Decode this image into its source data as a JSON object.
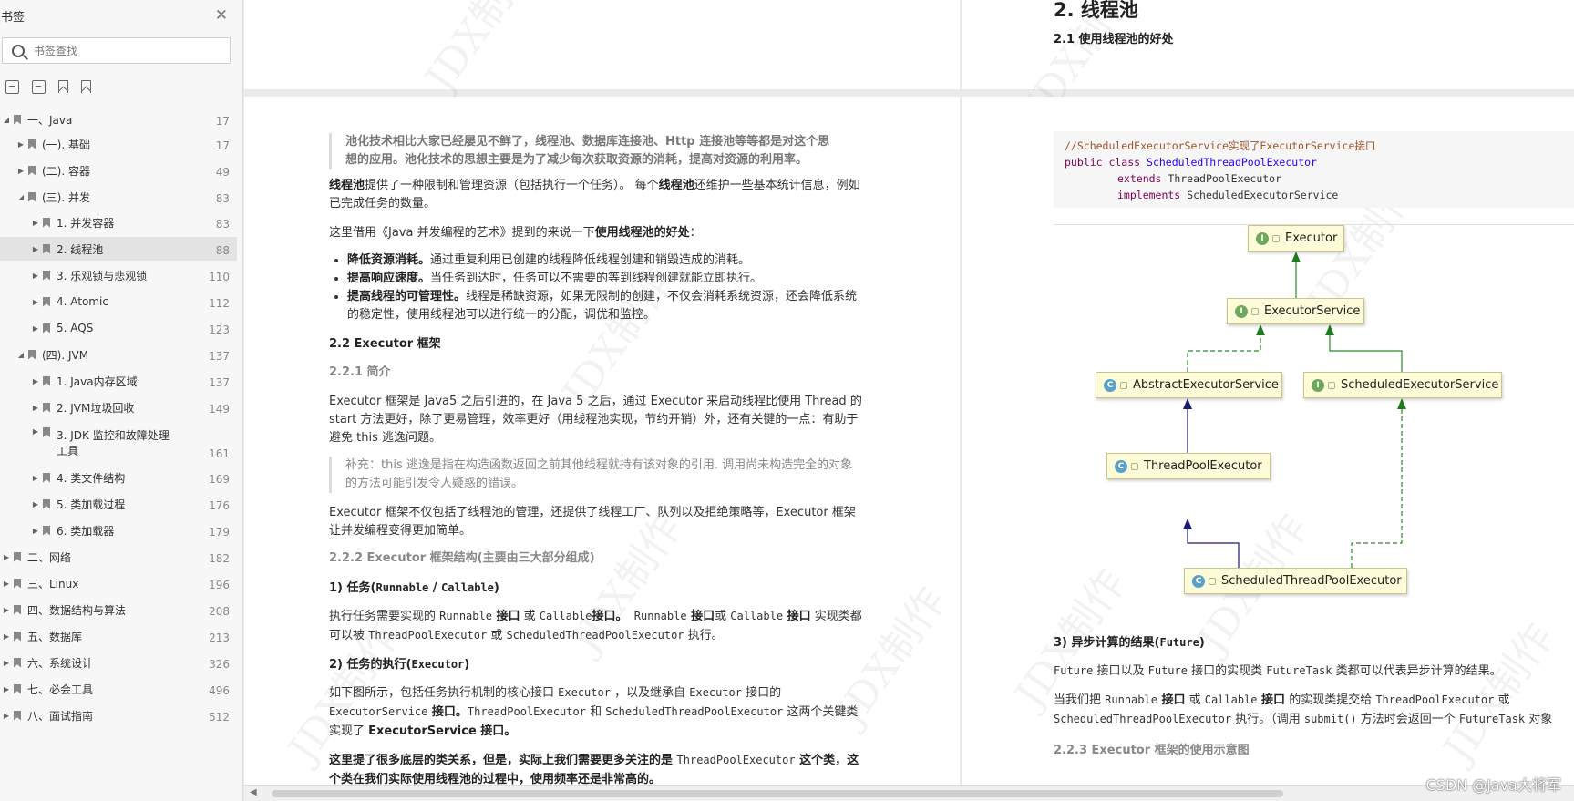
{
  "sidebar": {
    "title": "书签",
    "close": "✕",
    "search_placeholder": "书签查找",
    "items": [
      {
        "label": "一、Java",
        "page": "17",
        "arrow": "◢"
      },
      {
        "label": "(一). 基础",
        "page": "17",
        "arrow": "▶"
      },
      {
        "label": "(二). 容器",
        "page": "49",
        "arrow": "▶"
      },
      {
        "label": "(三). 并发",
        "page": "83",
        "arrow": "◢"
      },
      {
        "label": "1. 并发容器",
        "page": "83",
        "arrow": "▶"
      },
      {
        "label": "2. 线程池",
        "page": "88",
        "arrow": "▶"
      },
      {
        "label": "3. 乐观锁与悲观锁",
        "page": "110",
        "arrow": "▶"
      },
      {
        "label": "4. Atomic",
        "page": "112",
        "arrow": "▶"
      },
      {
        "label": "5. AQS",
        "page": "123",
        "arrow": "▶"
      },
      {
        "label": "(四). JVM",
        "page": "137",
        "arrow": "◢"
      },
      {
        "label": "1. Java内存区域",
        "page": "137",
        "arrow": "▶"
      },
      {
        "label": "2. JVM垃圾回收",
        "page": "149",
        "arrow": "▶"
      },
      {
        "label": "3. JDK 监控和故障处理",
        "label2": "工具",
        "page": "161",
        "arrow": "▶"
      },
      {
        "label": "4. 类文件结构",
        "page": "169",
        "arrow": "▶"
      },
      {
        "label": "5. 类加载过程",
        "page": "176",
        "arrow": "▶"
      },
      {
        "label": "6. 类加载器",
        "page": "179",
        "arrow": "▶"
      },
      {
        "label": "二、网络",
        "page": "182",
        "arrow": "▶"
      },
      {
        "label": "三、Linux",
        "page": "196",
        "arrow": "▶"
      },
      {
        "label": "四、数据结构与算法",
        "page": "208",
        "arrow": "▶"
      },
      {
        "label": "五、数据库",
        "page": "213",
        "arrow": "▶"
      },
      {
        "label": "六、系统设计",
        "page": "326",
        "arrow": "▶"
      },
      {
        "label": "七、必会工具",
        "page": "496",
        "arrow": "▶"
      },
      {
        "label": "八、面试指南",
        "page": "512",
        "arrow": "▶"
      }
    ]
  },
  "top_right": {
    "h1": "2. 线程池",
    "h2": "2.1 使用线程池的好处"
  },
  "left_page": {
    "quote1": "池化技术相比大家已经屡见不鲜了，线程池、数据库连接池、Http 连接池等等都是对这个思想的应用。池化技术的思想主要是为了减少每次获取资源的消耗，提高对资源的利用率。",
    "p1_bold1": "线程池",
    "p1_text1": "提供了一种限制和管理资源（包括执行一个任务）。 每个",
    "p1_bold2": "线程池",
    "p1_text2": "还维护一些基本统计信息，例如已完成任务的数量。",
    "p2_text": "这里借用《Java 并发编程的艺术》提到的来说一下",
    "p2_bold": "使用线程池的好处",
    "p2_end": "：",
    "bullets": [
      {
        "bold": "降低资源消耗。",
        "text": "通过重复利用已创建的线程降低线程创建和销毁造成的消耗。"
      },
      {
        "bold": "提高响应速度。",
        "text": "当任务到达时，任务可以不需要的等到线程创建就能立即执行。"
      },
      {
        "bold": "提高线程的可管理性。",
        "text": "线程是稀缺资源，如果无限制的创建，不仅会消耗系统资源，还会降低系统的稳定性，使用线程池可以进行统一的分配，调优和监控。"
      }
    ],
    "h_22": "2.2 Executor 框架",
    "h_221": "2.2.1 简介",
    "p3": "Executor 框架是 Java5 之后引进的，在 Java 5 之后，通过 Executor 来启动线程比使用 Thread 的 start 方法更好，除了更易管理，效率更好（用线程池实现，节约开销）外，还有关键的一点：有助于避免 this 逃逸问题。",
    "quote2": "补充：this 逃逸是指在构造函数返回之前其他线程就持有该对象的引用. 调用尚未构造完全的对象的方法可能引发令人疑惑的错误。",
    "p4": "Executor 框架不仅包括了线程池的管理，还提供了线程工厂、队列以及拒绝策略等，Executor 框架让并发编程变得更加简单。",
    "h_222": "2.2.2 Executor 框架结构(主要由三大部分组成)",
    "h_task": "1) 任务(",
    "h_task_code": "Runnable",
    "h_task_sep": " / ",
    "h_task_code2": "Callable",
    "h_task_end": ")",
    "p5_a": "执行任务需要实现的 ",
    "p5_c1": "Runnable",
    "p5_b1": " 接口",
    "p5_or": " 或 ",
    "p5_c2": "Callable",
    "p5_b2": "接口。",
    "p5_c3": " Runnable",
    "p5_b3": " 接口",
    "p5_or2": "或 ",
    "p5_c4": "Callable",
    "p5_b4": " 接口",
    "p5_t2": " 实现类都可以被 ",
    "p5_c5": "ThreadPoolExecutor",
    "p5_or3": " 或 ",
    "p5_c6": "ScheduledThreadPoolExecutor",
    "p5_end": " 执行。",
    "h_exec": "2) 任务的执行(",
    "h_exec_code": "Executor",
    "h_exec_end": ")",
    "p6_a": "如下图所示，包括任务执行机制的核心接口 ",
    "p6_c1": "Executor",
    "p6_b": " ，以及继承自 ",
    "p6_c2": "Executor",
    "p6_c": " 接口的",
    "p6_c3": "ExecutorService",
    "p6_b1": " 接口。",
    "p6_c4": "ThreadPoolExecutor",
    "p6_d": " 和 ",
    "p6_c5": "ScheduledThreadPoolExecutor",
    "p6_e": " 这两个关键类实现了 ",
    "p6_b2": "ExecutorService 接口。",
    "p7_b1": "这里提了很多底层的类关系，但是，实际上我们需要更多关注的是 ",
    "p7_c": "ThreadPoolExecutor",
    "p7_b2": " 这个类，这个类在我们实际使用线程池的过程中，使用频率还是非常高的。"
  },
  "right_page": {
    "code": {
      "comment": "//ScheduledExecutorService实现了ExecutorService接口",
      "kw1": "public class",
      "cls": "ScheduledThreadPoolExecutor",
      "kw2": "extends",
      "sup": "ThreadPoolExecutor",
      "kw3": "implements",
      "iface": "ScheduledExecutorService"
    },
    "uml": {
      "executor": "Executor",
      "executor_service": "ExecutorService",
      "abstract_executor_service": "AbstractExecutorService",
      "scheduled_executor_service": "ScheduledExecutorService",
      "thread_pool_executor": "ThreadPoolExecutor",
      "scheduled_thread_pool_executor": "ScheduledThreadPoolExecutor",
      "icon_i": "I",
      "icon_c": "C"
    },
    "h_result": "3) 异步计算的结果(",
    "h_result_code": "Future",
    "h_result_end": ")",
    "p1_c1": "Future",
    "p1_a": " 接口以及 ",
    "p1_c2": "Future",
    "p1_b": " 接口的实现类 ",
    "p1_c3": "FutureTask",
    "p1_d": " 类都可以代表异步计算的结果。",
    "p2_a": "当我们把 ",
    "p2_c1": "Runnable",
    "p2_b1": " 接口",
    "p2_or": " 或 ",
    "p2_c2": "Callable",
    "p2_b2": " 接口",
    "p2_t": " 的实现类提交给 ",
    "p2_c3": "ThreadPoolExecutor",
    "p2_or2": " 或",
    "p2_c4": "ScheduledThreadPoolExecutor",
    "p2_t2": " 执行。（调用 ",
    "p2_c5": "submit()",
    "p2_t3": " 方法时会返回一个 ",
    "p2_c6": "FutureTask",
    "p2_t4": " 对象",
    "h_223": "2.2.3 Executor 框架的使用示意图"
  },
  "watermark": "JDX制作",
  "credit": "CSDN @Java大将军",
  "scroll_left": "◀",
  "colors": {
    "sidebar_bg": "#f7f7f7",
    "page_bg": "#ffffff",
    "gutter": "#ebebeb",
    "uml_box": "#fefbd8",
    "code_comment": "#a0522d",
    "code_keyword": "#7f0055",
    "code_class": "#2a00ff"
  }
}
